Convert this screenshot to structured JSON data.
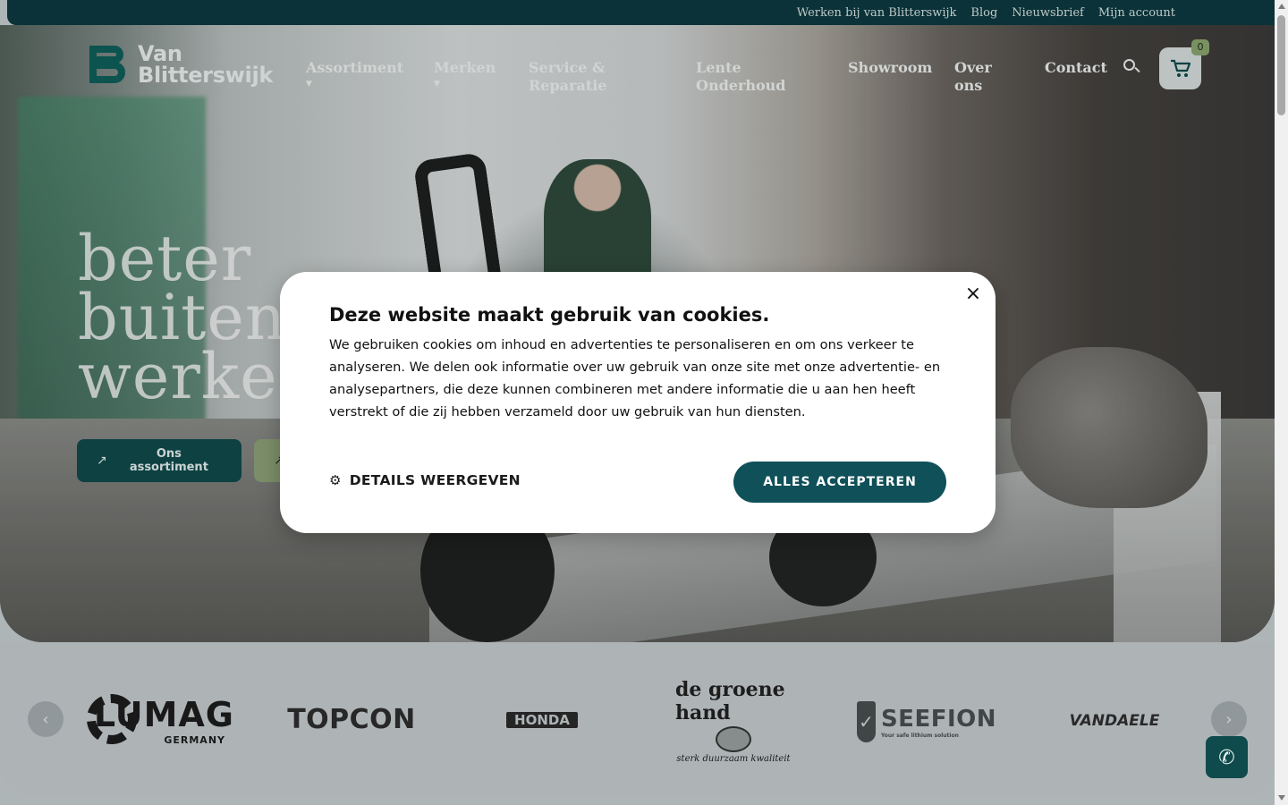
{
  "topbar": {
    "links": [
      "Werken bij van Blitterswijk",
      "Blog",
      "Nieuwsbrief",
      "Mijn account"
    ]
  },
  "header": {
    "logo_line1": "Van",
    "logo_line2": "Blitterswijk",
    "nav": [
      {
        "label": "Assortiment",
        "has_dropdown": true
      },
      {
        "label": "Merken",
        "has_dropdown": true
      },
      {
        "label": "Service & Reparatie",
        "has_dropdown": false
      },
      {
        "label": "Lente Onderhoud",
        "has_dropdown": false
      },
      {
        "label": "Showroom",
        "has_dropdown": false
      },
      {
        "label": "Over ons",
        "has_dropdown": false
      },
      {
        "label": "Contact",
        "has_dropdown": false
      }
    ],
    "cart_count": "0",
    "icons": {
      "search": "search-icon",
      "cart": "cart-icon"
    }
  },
  "hero": {
    "title_lines": [
      "beter",
      "buiten",
      "werken"
    ],
    "buttons": [
      {
        "label": "Ons assortiment"
      },
      {
        "label": ""
      }
    ],
    "arrow": "↗"
  },
  "brands": {
    "prev": "‹",
    "next": "›",
    "items": {
      "lumag": {
        "name": "LUMAG",
        "sub": "GERMANY"
      },
      "topcon": {
        "name": "TOPCON"
      },
      "honda": {
        "name": "HONDA"
      },
      "groene_hand": {
        "name": "de groene hand",
        "tagline": "sterk duurzaam kwaliteit"
      },
      "seefion": {
        "name": "SEEFION",
        "sub": "Your safe lithium solution"
      },
      "vandaele": {
        "name": "VANDAELE"
      }
    }
  },
  "whatsapp": {
    "icon": "whatsapp-icon",
    "glyph": "✆"
  },
  "cookie_modal": {
    "title": "Deze website maakt gebruik van cookies.",
    "body": "We gebruiken cookies om inhoud en advertenties te personaliseren en om ons verkeer te analyseren. We delen ook informatie over uw gebruik van onze site met onze advertentie- en analysepartners, die deze kunnen combineren met andere informatie die u aan hen heeft verstrekt of die zij hebben verzameld door uw gebruik van hun diensten.",
    "details_label": "DETAILS WEERGEVEN",
    "accept_label": "ALLES ACCEPTEREN",
    "close_glyph": "×"
  },
  "colors": {
    "brand_dark_teal": "#0f4a4c",
    "topbar": "#0c3a40",
    "accent_green": "#8aa56f",
    "accept_button": "#0f5059"
  }
}
